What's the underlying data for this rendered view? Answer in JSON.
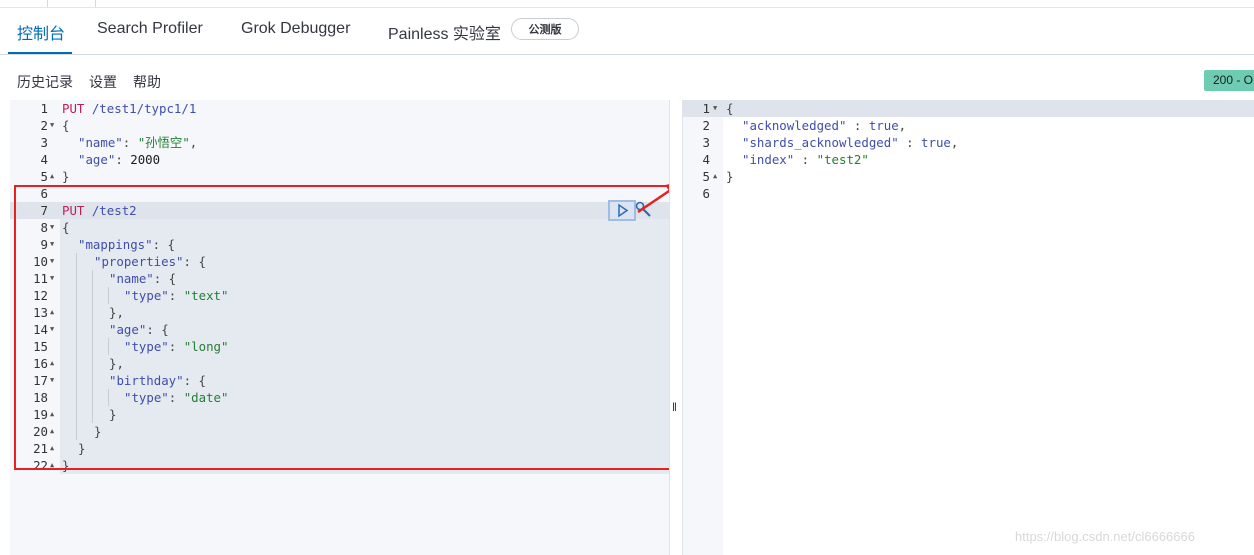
{
  "tabs": [
    {
      "label": "控制台",
      "active": true
    },
    {
      "label": "Search Profiler",
      "active": false
    },
    {
      "label": "Grok Debugger",
      "active": false
    },
    {
      "label": "Painless 实验室",
      "active": false
    }
  ],
  "beta_badge": "公测版",
  "toolbar": {
    "history": "历史记录",
    "settings": "设置",
    "help": "帮助"
  },
  "status": "200 - O",
  "colors": {
    "accent": "#006bb4",
    "highlight_box": "#e8201f",
    "status_bg": "#6dccb1"
  },
  "request": {
    "line_numbers": [
      "1",
      "2",
      "3",
      "4",
      "5",
      "6",
      "7",
      "8",
      "9",
      "10",
      "11",
      "12",
      "13",
      "14",
      "15",
      "16",
      "17",
      "18",
      "19",
      "20",
      "21",
      "22"
    ],
    "l1": {
      "method": "PUT",
      "path": " /test1/typc1/1"
    },
    "l2": "{",
    "l3": {
      "key": "\"name\"",
      "colon": ": ",
      "val": "\"孙悟空\"",
      "tail": ","
    },
    "l4": {
      "key": "\"age\"",
      "colon": ": ",
      "val": "2000"
    },
    "l5": "}",
    "l7": {
      "method": "PUT",
      "path": " /test2"
    },
    "l8": "{",
    "l9": {
      "key": "\"mappings\"",
      "rest": ": {"
    },
    "l10": {
      "key": "\"properties\"",
      "rest": ": {"
    },
    "l11": {
      "key": "\"name\"",
      "rest": ": {"
    },
    "l12": {
      "key": "\"type\"",
      "colon": ": ",
      "val": "\"text\""
    },
    "l13": "},",
    "l14": {
      "key": "\"age\"",
      "rest": ": {"
    },
    "l15": {
      "key": "\"type\"",
      "colon": ": ",
      "val": "\"long\""
    },
    "l16": "},",
    "l17": {
      "key": "\"birthday\"",
      "rest": ": {"
    },
    "l18": {
      "key": "\"type\"",
      "colon": ": ",
      "val": "\"date\""
    },
    "l19": "}",
    "l20": "}",
    "l21": "}",
    "l22": "}"
  },
  "response": {
    "line_numbers": [
      "1",
      "2",
      "3",
      "4",
      "5",
      "6"
    ],
    "l1": "{",
    "l2": {
      "key": "\"acknowledged\"",
      "colon": " : ",
      "val": "true",
      "tail": ","
    },
    "l3": {
      "key": "\"shards_acknowledged\"",
      "colon": " : ",
      "val": "true",
      "tail": ","
    },
    "l4": {
      "key": "\"index\"",
      "colon": " : ",
      "val": "\"test2\""
    },
    "l5": "}"
  },
  "watermark": "https://blog.csdn.net/cl6666666"
}
